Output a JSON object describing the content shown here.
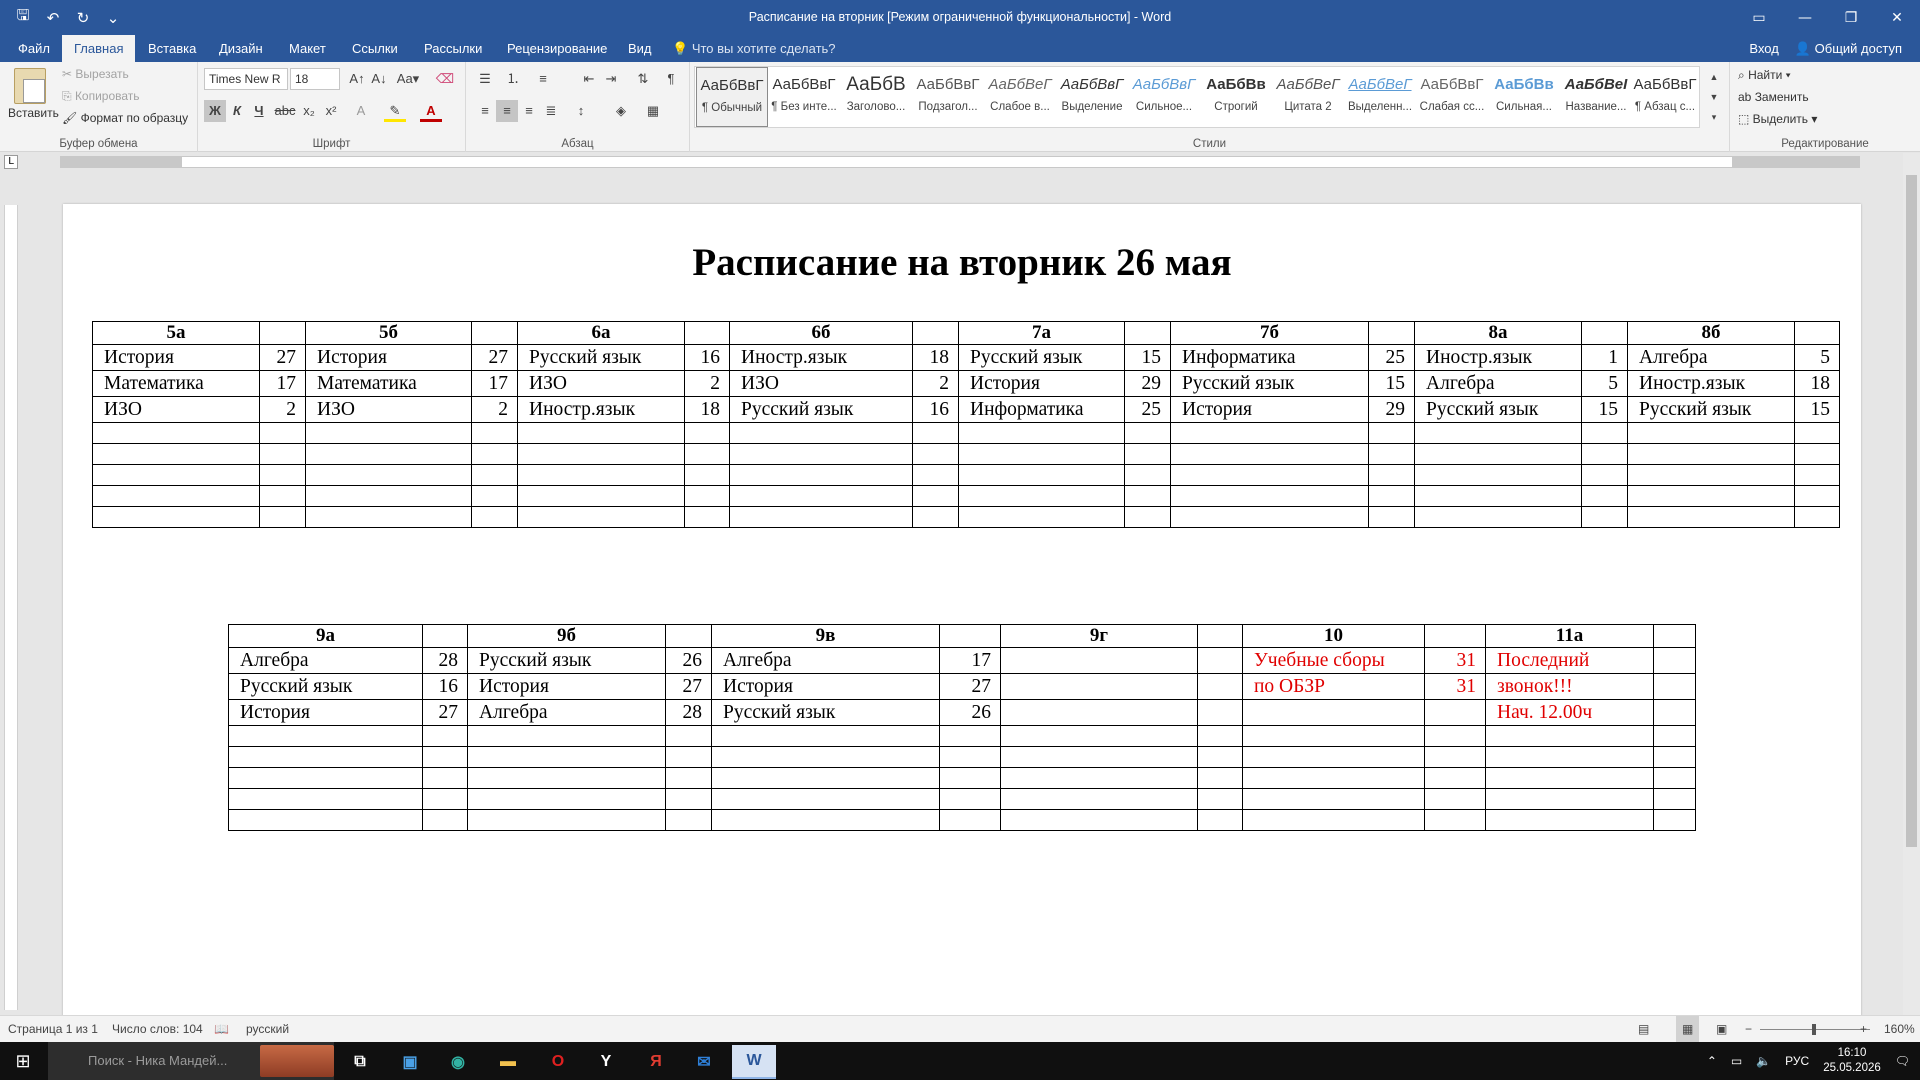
{
  "window": {
    "title": "Расписание на вторник [Режим ограниченной функциональности] - Word"
  },
  "tabs": [
    "Файл",
    "Главная",
    "Вставка",
    "Дизайн",
    "Макет",
    "Ссылки",
    "Рассылки",
    "Рецензирование",
    "Вид"
  ],
  "tell_me": "Что вы хотите сделать?",
  "account": {
    "signin": "Вход",
    "share": "Общий доступ"
  },
  "clipboard": {
    "paste": "Вставить",
    "cut": "Вырезать",
    "copy": "Копировать",
    "format_painter": "Формат по образцу",
    "group": "Буфер обмена"
  },
  "font": {
    "name": "Times New R",
    "size": "18",
    "group": "Шрифт",
    "bold_label": "Ж",
    "italic_label": "К",
    "underline_label": "Ч"
  },
  "paragraph": {
    "group": "Абзац"
  },
  "styles": {
    "group": "Стили",
    "items": [
      {
        "sample": "АаБбВвГ",
        "name": "¶ Обычный"
      },
      {
        "sample": "АаБбВвГ",
        "name": "¶ Без инте..."
      },
      {
        "sample": "АаБбВ",
        "name": "Заголово..."
      },
      {
        "sample": "АаБбВвГ",
        "name": "Подзагол..."
      },
      {
        "sample": "АаБбВеГ",
        "name": "Слабое в..."
      },
      {
        "sample": "АаБбВвГ",
        "name": "Выделение"
      },
      {
        "sample": "АаБбВвГ",
        "name": "Сильное..."
      },
      {
        "sample": "АаБбВв",
        "name": "Строгий"
      },
      {
        "sample": "АаБбВеГ",
        "name": "Цитата 2"
      },
      {
        "sample": "АаБбВеГ",
        "name": "Выделенн..."
      },
      {
        "sample": "АаБбВвГ",
        "name": "Слабая сс..."
      },
      {
        "sample": "АаБбВв",
        "name": "Сильная..."
      },
      {
        "sample": "АаБбВеI",
        "name": "Название..."
      },
      {
        "sample": "АаБбВвГ",
        "name": "¶ Абзац с..."
      }
    ]
  },
  "editing": {
    "group": "Редактирование",
    "find": "Найти",
    "replace": "Заменить",
    "select": "Выделить"
  },
  "document": {
    "title": "Расписание на вторник 26 мая",
    "table1": {
      "headers": [
        "5а",
        "",
        "5б",
        "",
        "6а",
        "",
        "6б",
        "",
        "7а",
        "",
        "7б",
        "",
        "8а",
        "",
        "8б",
        ""
      ],
      "rows": [
        [
          "История",
          "27",
          "История",
          "27",
          "Русский язык",
          "16",
          "Иностр.язык",
          "18",
          "Русский язык",
          "15",
          "Информатика",
          "25",
          "Иностр.язык",
          "1",
          "Алгебра",
          "5"
        ],
        [
          "Математика",
          "17",
          "Математика",
          "17",
          "ИЗО",
          "2",
          "ИЗО",
          "2",
          "История",
          "29",
          "Русский язык",
          "15",
          "Алгебра",
          "5",
          "Иностр.язык",
          "18"
        ],
        [
          "ИЗО",
          "2",
          "ИЗО",
          "2",
          "Иностр.язык",
          "18",
          "Русский язык",
          "16",
          "Информатика",
          "25",
          "История",
          "29",
          "Русский язык",
          "15",
          "Русский язык",
          "15"
        ]
      ],
      "empty_rows": 5
    },
    "table2": {
      "headers": [
        "9а",
        "",
        "9б",
        "",
        "9в",
        "",
        "9г",
        "",
        "10",
        "",
        "11а",
        ""
      ],
      "rows": [
        [
          "Алгебра",
          "28",
          "Русский язык",
          "26",
          "Алгебра",
          "17",
          "",
          "",
          "Учебные сборы",
          "31",
          "Последний",
          ""
        ],
        [
          "Русский язык",
          "16",
          "История",
          "27",
          "История",
          "27",
          "",
          "",
          "по ОБЗР",
          "31",
          "звонок!!!",
          ""
        ],
        [
          "История",
          "27",
          "Алгебра",
          "28",
          "Русский язык",
          "26",
          "",
          "",
          "",
          "",
          "Нач. 12.00ч",
          ""
        ]
      ],
      "red_columns": [
        8,
        9,
        10
      ],
      "empty_rows": 5
    }
  },
  "statusbar": {
    "page": "Страница 1 из 1",
    "words": "Число слов: 104",
    "language": "русский",
    "zoom": "160%"
  },
  "taskbar": {
    "search_placeholder": "Поиск - Ника Мандей...",
    "language": "РУС",
    "time": "16:10",
    "date": "25.05.2026"
  },
  "colors": {
    "titlebar": "#2b579a",
    "ribbon": "#f3f3f3",
    "red_text": "#e00000",
    "taskbar": "#101010"
  }
}
